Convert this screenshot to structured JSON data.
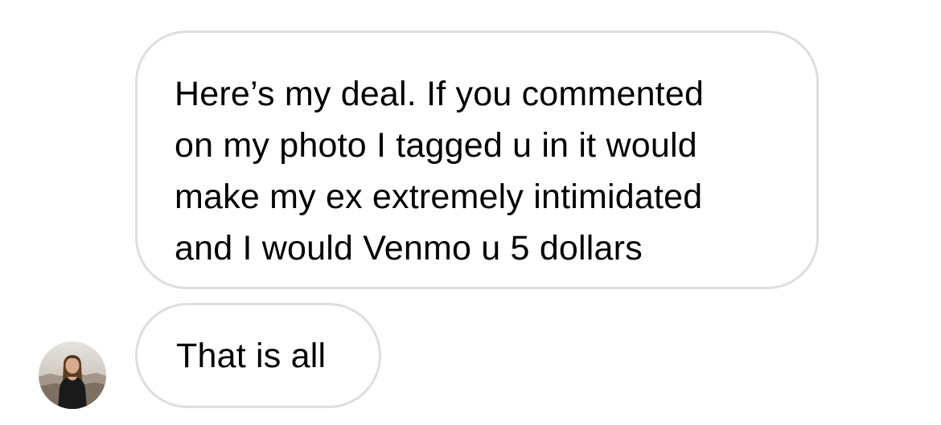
{
  "messages": [
    {
      "lines": [
        "Here’s my deal. If you commented",
        "on my photo I tagged u in it would",
        "make my ex extremely intimidated",
        "and I would Venmo u 5 dollars"
      ]
    },
    {
      "text": "That is all"
    }
  ],
  "avatar": {
    "icon": "person-photo"
  },
  "colors": {
    "background": "#ffffff",
    "bubble_border": "#dedede",
    "text": "#000000"
  }
}
